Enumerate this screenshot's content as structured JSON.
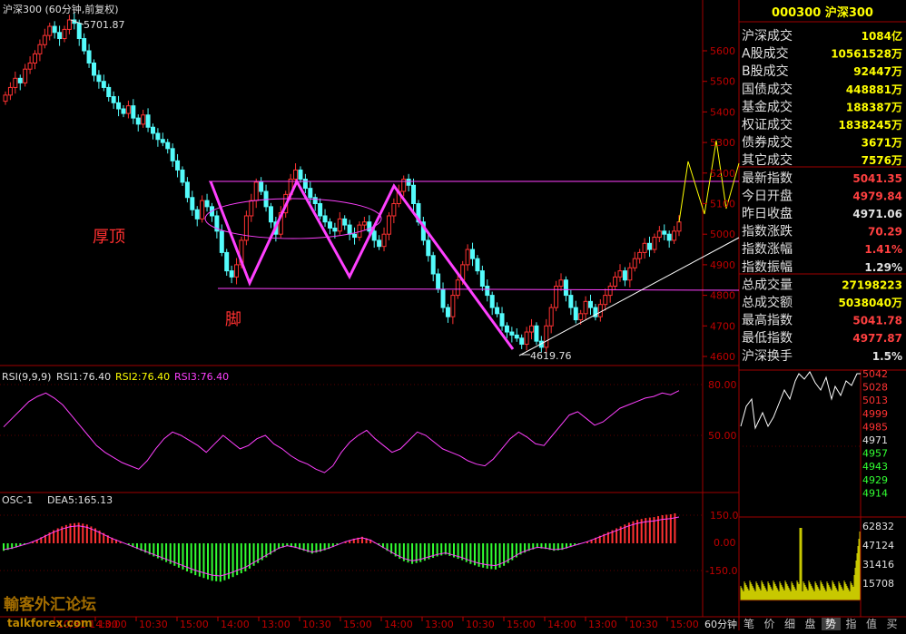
{
  "main_chart": {
    "title": "沪深300 (60分钟,前复权)",
    "high_label": "5701.87",
    "low_label": "4619.76",
    "annotation_top": "厚顶",
    "annotation_bottom": "脚",
    "y_ticks": [
      "5600",
      "5500",
      "5400",
      "5300",
      "5200",
      "5100",
      "5000",
      "4900",
      "4800",
      "4700",
      "4600"
    ],
    "x_labels": [
      "10/31 14:00",
      "13:00",
      "10:30",
      "15:00",
      "14:00",
      "13:00",
      "10:30",
      "15:00",
      "14:00",
      "13:00",
      "10:30",
      "15:00",
      "14:00",
      "13:00",
      "10:30",
      "15:00"
    ],
    "period_label": "60分钟"
  },
  "rsi_panel": {
    "label": "RSI(9,9,9)",
    "rsi1": "RSI1:76.40",
    "rsi2": "RSI2:76.40",
    "rsi3": "RSI3:76.40",
    "y_ticks": [
      "80.00",
      "50.00"
    ]
  },
  "osc_panel": {
    "label": "OSC-1",
    "dea": "DEA5:165.13",
    "y_ticks": [
      "150.0",
      "0.00",
      "-150.0"
    ]
  },
  "side_panel": {
    "header": "000300 沪深300",
    "rows": [
      {
        "label": "沪深成交",
        "value": "1084亿",
        "color": "#ffff00"
      },
      {
        "label": "A股成交",
        "value": "10561528万",
        "color": "#ffff00"
      },
      {
        "label": "B股成交",
        "value": "92447万",
        "color": "#ffff00"
      },
      {
        "label": "国债成交",
        "value": "448881万",
        "color": "#ffff00"
      },
      {
        "label": "基金成交",
        "value": "188387万",
        "color": "#ffff00"
      },
      {
        "label": "权证成交",
        "value": "1838245万",
        "color": "#ffff00"
      },
      {
        "label": "债券成交",
        "value": "3671万",
        "color": "#ffff00"
      },
      {
        "label": "其它成交",
        "value": "7576万",
        "color": "#ffff00"
      },
      {
        "label": "最新指数",
        "value": "5041.35",
        "color": "#ff4040"
      },
      {
        "label": "今日开盘",
        "value": "4979.84",
        "color": "#ff4040"
      },
      {
        "label": "昨日收盘",
        "value": "4971.06",
        "color": "#e0e0e0"
      },
      {
        "label": "指数涨跌",
        "value": "70.29",
        "color": "#ff4040"
      },
      {
        "label": "指数涨幅",
        "value": "1.41%",
        "color": "#ff4040"
      },
      {
        "label": "指数振幅",
        "value": "1.29%",
        "color": "#e0e0e0"
      },
      {
        "label": "总成交量",
        "value": "27198223",
        "color": "#ffff00"
      },
      {
        "label": "总成交额",
        "value": "5038040万",
        "color": "#ffff00"
      },
      {
        "label": "最高指数",
        "value": "5041.78",
        "color": "#ff4040"
      },
      {
        "label": "最低指数",
        "value": "4977.87",
        "color": "#ff4040"
      },
      {
        "label": "沪深换手",
        "value": "1.5%",
        "color": "#e0e0e0"
      }
    ],
    "mini_price_ticks": [
      "5042",
      "5028",
      "5013",
      "4999",
      "4985",
      "4971",
      "4957",
      "4943",
      "4929",
      "4914"
    ],
    "mini_volume_ticks": [
      "62832",
      "47124",
      "31416",
      "15708"
    ],
    "tabs": [
      "笔",
      "价",
      "细",
      "盘",
      "势",
      "指",
      "值",
      "买"
    ]
  },
  "watermark": {
    "text1": "輸客外汇论坛",
    "text2": "talkforex.com"
  },
  "chart_data": {
    "type": "candlestick",
    "ylim": [
      4560,
      5760
    ],
    "close": [
      5455,
      5480,
      5510,
      5495,
      5540,
      5560,
      5590,
      5620,
      5650,
      5680,
      5660,
      5640,
      5670,
      5701,
      5690,
      5640,
      5600,
      5560,
      5520,
      5500,
      5480,
      5450,
      5430,
      5410,
      5395,
      5420,
      5380,
      5360,
      5390,
      5350,
      5330,
      5310,
      5300,
      5280,
      5240,
      5210,
      5170,
      5120,
      5080,
      5050,
      5110,
      5090,
      5060,
      5010,
      4940,
      4880,
      4860,
      4900,
      4980,
      5060,
      5110,
      5170,
      5140,
      5090,
      5040,
      5000,
      5070,
      5130,
      5180,
      5210,
      5180,
      5150,
      5120,
      5100,
      5060,
      5040,
      5020,
      5010,
      5050,
      5030,
      5000,
      4990,
      5030,
      5040,
      5010,
      4980,
      4960,
      5000,
      5060,
      5100,
      5140,
      5180,
      5160,
      5100,
      5040,
      4980,
      4930,
      4870,
      4820,
      4760,
      4730,
      4800,
      4850,
      4900,
      4950,
      4920,
      4880,
      4830,
      4800,
      4760,
      4740,
      4700,
      4680,
      4670,
      4660,
      4640,
      4680,
      4700,
      4650,
      4630,
      4700,
      4760,
      4830,
      4850,
      4800,
      4760,
      4720,
      4740,
      4780,
      4760,
      4730,
      4770,
      4800,
      4830,
      4860,
      4880,
      4850,
      4890,
      4920,
      4940,
      4970,
      4950,
      4990,
      5010,
      5000,
      4980,
      5010,
      5040
    ],
    "swing_high": 5701.87,
    "swing_low": 4619.76,
    "resistance_level": 5235,
    "support_level": 4820,
    "rsi": {
      "name": "RSI1",
      "values": [
        55,
        60,
        65,
        70,
        73,
        75,
        72,
        68,
        62,
        56,
        50,
        44,
        40,
        37,
        34,
        32,
        30,
        35,
        42,
        48,
        52,
        50,
        47,
        44,
        40,
        45,
        50,
        46,
        42,
        44,
        48,
        50,
        45,
        42,
        38,
        35,
        33,
        30,
        28,
        32,
        40,
        46,
        50,
        53,
        48,
        44,
        40,
        42,
        47,
        52,
        50,
        46,
        42,
        40,
        38,
        35,
        33,
        32,
        36,
        42,
        48,
        52,
        49,
        45,
        44,
        50,
        56,
        62,
        64,
        60,
        56,
        58,
        62,
        66,
        68,
        70,
        72,
        73,
        75,
        74,
        76.4
      ]
    },
    "osc": {
      "values": [
        -40,
        -30,
        -15,
        0,
        20,
        45,
        70,
        90,
        105,
        110,
        100,
        80,
        55,
        30,
        10,
        -10,
        -30,
        -50,
        -70,
        -90,
        -110,
        -130,
        -150,
        -170,
        -185,
        -200,
        -205,
        -190,
        -170,
        -150,
        -120,
        -90,
        -60,
        -30,
        -15,
        -25,
        -40,
        -55,
        -45,
        -30,
        -10,
        10,
        25,
        35,
        20,
        -10,
        -40,
        -70,
        -95,
        -110,
        -100,
        -85,
        -70,
        -60,
        -75,
        -90,
        -110,
        -125,
        -135,
        -140,
        -120,
        -90,
        -60,
        -40,
        -25,
        -30,
        -40,
        -35,
        -20,
        -5,
        10,
        30,
        50,
        70,
        90,
        110,
        125,
        135,
        140,
        150,
        155,
        165.13
      ]
    }
  }
}
